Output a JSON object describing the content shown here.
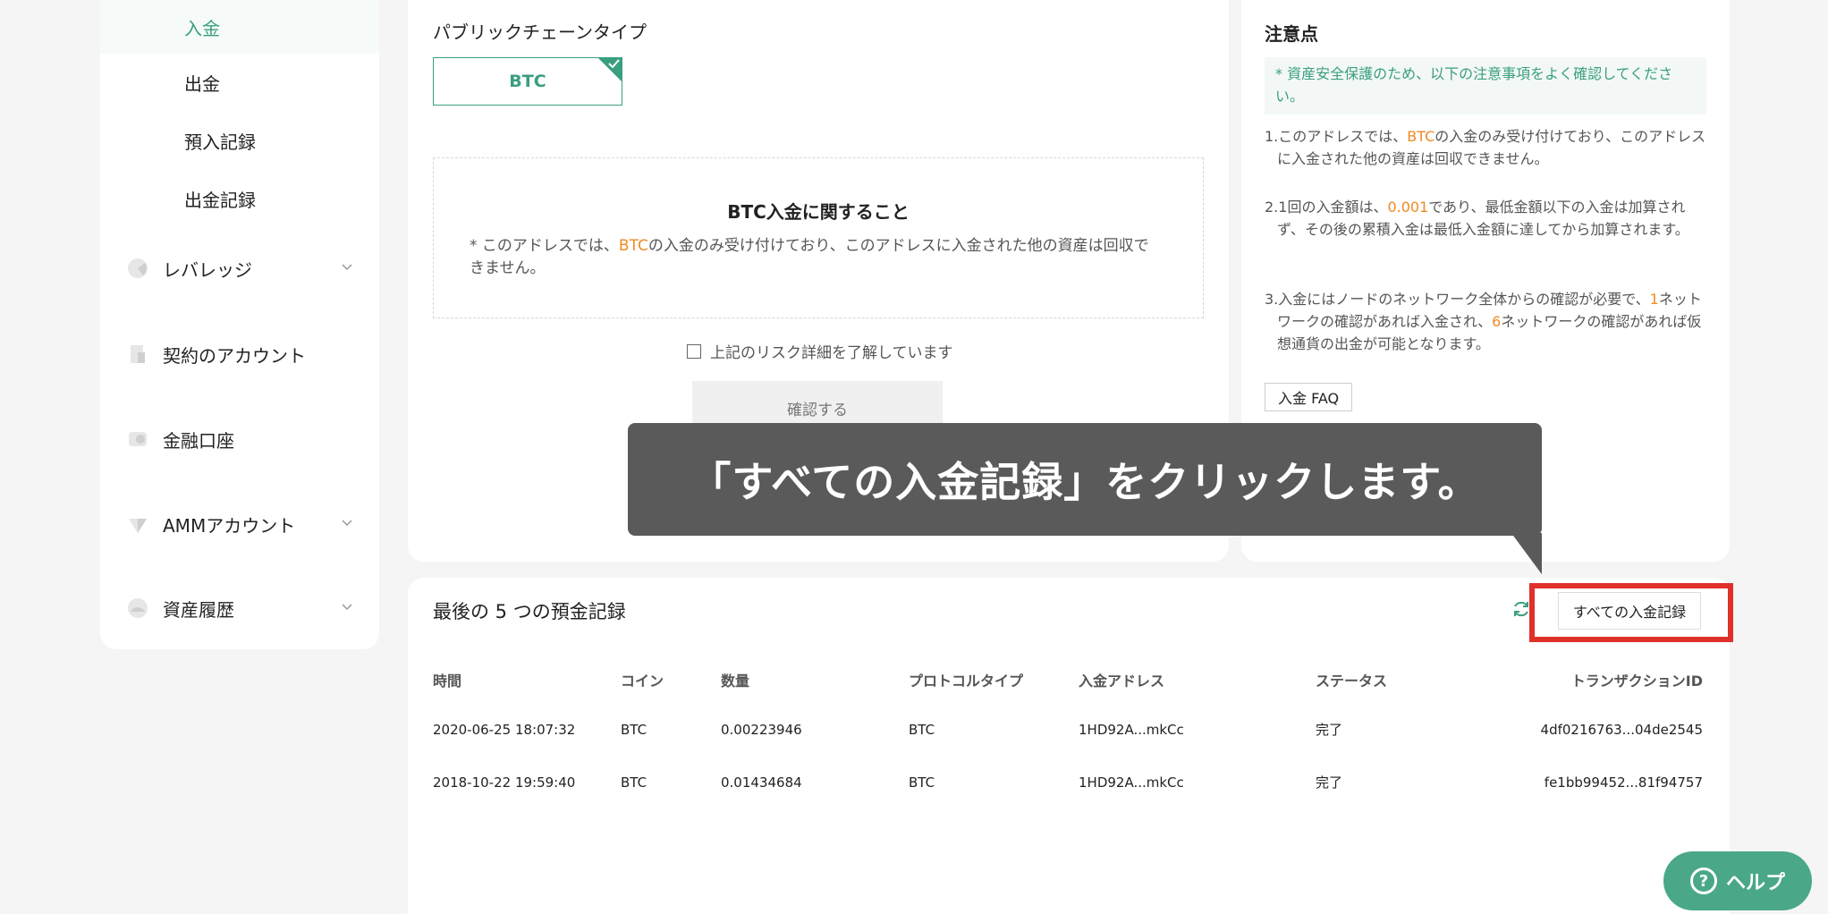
{
  "sidebar": {
    "deposit_sub": [
      {
        "label": "入金",
        "active": true
      },
      {
        "label": "出金",
        "active": false
      },
      {
        "label": "預入記録",
        "active": false
      },
      {
        "label": "出金記録",
        "active": false
      }
    ],
    "main_items": [
      {
        "label": "レバレッジ",
        "icon": "leverage-icon",
        "has_chevron": true
      },
      {
        "label": "契約のアカウント",
        "icon": "contract-icon",
        "has_chevron": false
      },
      {
        "label": "金融口座",
        "icon": "finance-icon",
        "has_chevron": false
      },
      {
        "label": "AMMアカウント",
        "icon": "amm-icon",
        "has_chevron": true
      },
      {
        "label": "資産履歴",
        "icon": "asset-history-icon",
        "has_chevron": true
      }
    ]
  },
  "deposit": {
    "chain_type_label": "パブリックチェーンタイプ",
    "chain_selected": "BTC",
    "info_title": "BTC入金に関すること",
    "info_prefix": "* このアドレスでは、",
    "info_coin": "BTC",
    "info_suffix": "の入金のみ受け付けており、このアドレスに入金された他の資産は回収できません。",
    "risk_checkbox": "上記のリスク詳細を了解しています",
    "confirm_button": "確認する"
  },
  "notes": {
    "title": "注意点",
    "banner": "* 資産安全保護のため、以下の注意事項をよく確認してください。",
    "note1_a": "1.このアドレスでは、",
    "note1_coin": "BTC",
    "note1_b": "の入金のみ受け付けており、このアドレスに入金された他の資産は回収できません。",
    "note2_a": "2.1回の入金額は、",
    "note2_amount": "0.001",
    "note2_b": "であり、最低金額以下の入金は加算されず、その後の累積入金は最低入金額に達してから加算されます。",
    "note3_a": "3.入金にはノードのネットワーク全体からの確認が必要で、",
    "note3_n1": "1",
    "note3_b": "ネットワークの確認があれば入金され、",
    "note3_n2": "6",
    "note3_c": "ネットワークの確認があれば仮想通貨の出金が可能となります。",
    "faq_button": "入金 FAQ"
  },
  "records": {
    "title": "最後の 5 つの預金記録",
    "all_button": "すべての入金記録",
    "columns": [
      "時間",
      "コイン",
      "数量",
      "プロトコルタイプ",
      "入金アドレス",
      "ステータス",
      "トランザクションID"
    ],
    "rows": [
      {
        "time": "2020-06-25 18:07:32",
        "coin": "BTC",
        "amount": "0.00223946",
        "protocol": "BTC",
        "address": "1HD92A...mkCc",
        "status": "完了",
        "txid": "4df0216763...04de2545"
      },
      {
        "time": "2018-10-22 19:59:40",
        "coin": "BTC",
        "amount": "0.01434684",
        "protocol": "BTC",
        "address": "1HD92A...mkCc",
        "status": "完了",
        "txid": "fe1bb99452...81f94757"
      }
    ]
  },
  "tooltip": {
    "text": "「すべての入金記録」をクリックします。"
  },
  "help": {
    "label": "ヘルプ",
    "icon": "question-icon"
  },
  "colors": {
    "accent": "#3a9e80",
    "highlight": "#f08a24",
    "annotation": "#e0302a",
    "tooltip_bg": "#5a5a5a"
  }
}
